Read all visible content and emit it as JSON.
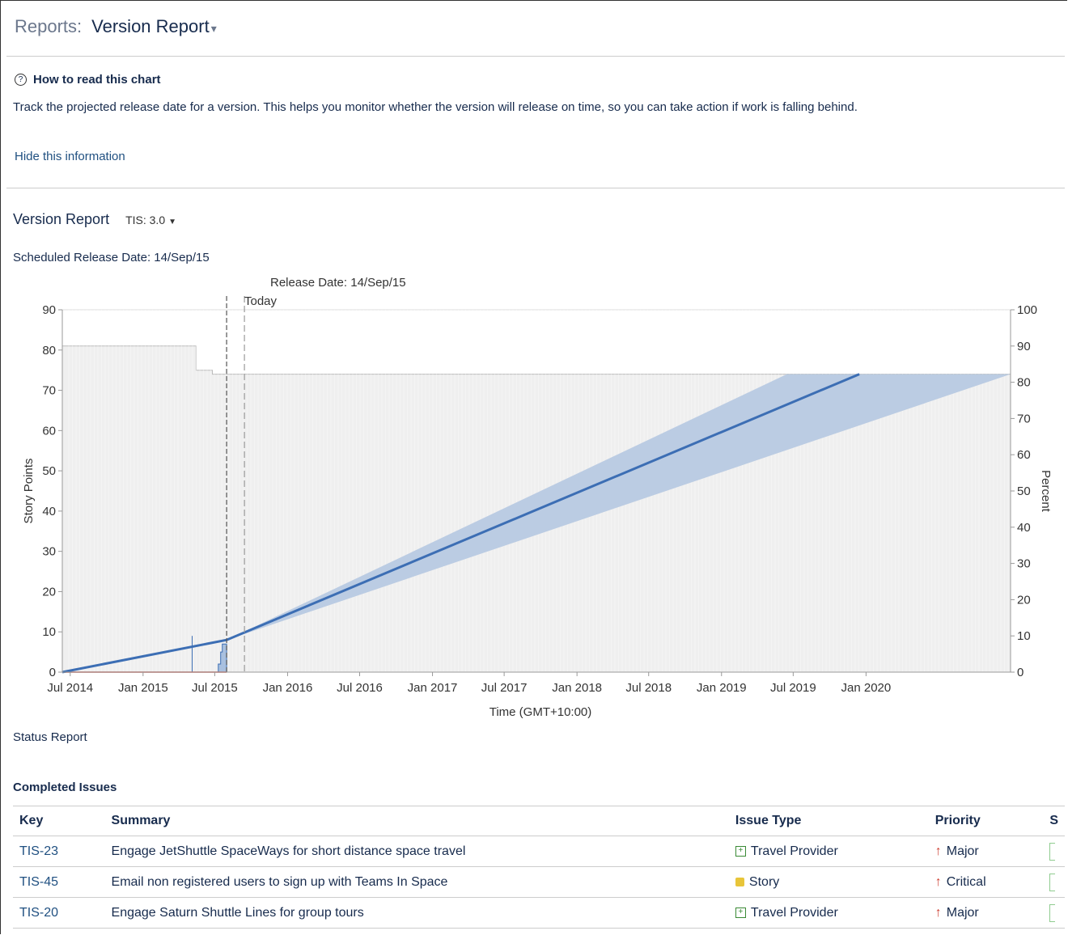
{
  "header": {
    "prefix": "Reports:",
    "title": "Version Report"
  },
  "help": {
    "heading": "How to read this chart",
    "text": "Track the projected release date for a version. This helps you monitor whether the version will release on time, so you can take action if work is falling behind.",
    "hide_link": "Hide this information"
  },
  "report": {
    "label": "Version Report",
    "version_select": "TIS: 3.0",
    "scheduled": "Scheduled Release Date: 14/Sep/15"
  },
  "chart_data": {
    "type": "line",
    "annotations": {
      "release": "Release Date: 14/Sep/15",
      "today": "Today"
    },
    "xlabel": "Time (GMT+10:00)",
    "ylabel": "Story Points",
    "y2label": "Percent",
    "x_ticks": [
      "Jul 2014",
      "Jan 2015",
      "Jul 2015",
      "Jan 2016",
      "Jul 2016",
      "Jan 2017",
      "Jul 2017",
      "Jan 2018",
      "Jul 2018",
      "Jan 2019",
      "Jul 2019",
      "Jan 2020"
    ],
    "ylim": [
      0,
      90
    ],
    "y_ticks": [
      0,
      10,
      20,
      30,
      40,
      50,
      60,
      70,
      80,
      90
    ],
    "y2lim": [
      0,
      100
    ],
    "y2_ticks": [
      0,
      10,
      20,
      30,
      40,
      50,
      60,
      70,
      80,
      90,
      100
    ],
    "today_date": "2015-07-31",
    "release_date": "2015-09-14",
    "total_scope": [
      {
        "x": "2014-06-11",
        "y": 81
      },
      {
        "x": "2015-05-15",
        "y": 81
      },
      {
        "x": "2015-05-15",
        "y": 75
      },
      {
        "x": "2015-06-25",
        "y": 75
      },
      {
        "x": "2015-06-25",
        "y": 74
      },
      {
        "x": "2020-12-31",
        "y": 74
      }
    ],
    "completed_line": [
      {
        "x": "2014-06-11",
        "y": 0
      },
      {
        "x": "2015-07-31",
        "y": 8
      },
      {
        "x": "2019-12-15",
        "y": 74
      }
    ],
    "projection_upper": [
      {
        "x": "2015-07-31",
        "y": 8
      },
      {
        "x": "2019-06-15",
        "y": 74
      }
    ],
    "projection_lower": [
      {
        "x": "2015-07-31",
        "y": 8
      },
      {
        "x": "2020-12-31",
        "y": 74
      }
    ],
    "completed_work_steps": [
      {
        "x": "2015-07-10",
        "y": 0
      },
      {
        "x": "2015-07-10",
        "y": 2
      },
      {
        "x": "2015-07-16",
        "y": 2
      },
      {
        "x": "2015-07-16",
        "y": 5
      },
      {
        "x": "2015-07-20",
        "y": 5
      },
      {
        "x": "2015-07-20",
        "y": 7
      },
      {
        "x": "2015-07-31",
        "y": 7
      },
      {
        "x": "2015-07-31",
        "y": 0
      }
    ],
    "spike": {
      "x": "2015-05-05",
      "y": 9
    },
    "unestimated_line": [
      {
        "x": "2014-06-11",
        "y": 0
      },
      {
        "x": "2015-07-31",
        "y": 0
      }
    ],
    "colors": {
      "line": "#3c6eb4",
      "band": "#b7c9e2",
      "scope": "#efefef",
      "unestimated": "#d04437"
    }
  },
  "status_report": "Status Report",
  "completed_issues": {
    "title": "Completed Issues",
    "columns": [
      "Key",
      "Summary",
      "Issue Type",
      "Priority",
      "S"
    ],
    "rows": [
      {
        "key": "TIS-23",
        "summary": "Engage JetShuttle SpaceWays for short distance space travel",
        "type": "Travel Provider",
        "type_icon": "travel-provider-icon",
        "priority": "Major"
      },
      {
        "key": "TIS-45",
        "summary": "Email non registered users to sign up with Teams In Space",
        "type": "Story",
        "type_icon": "story-icon",
        "priority": "Critical"
      },
      {
        "key": "TIS-20",
        "summary": "Engage Saturn Shuttle Lines for group tours",
        "type": "Travel Provider",
        "type_icon": "travel-provider-icon",
        "priority": "Major"
      }
    ]
  }
}
